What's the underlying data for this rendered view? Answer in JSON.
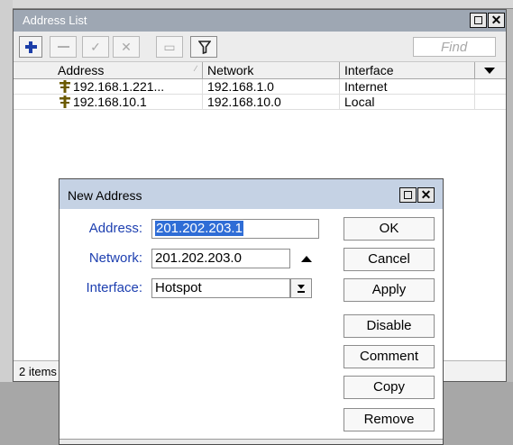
{
  "address_list": {
    "title": "Address List",
    "find_placeholder": "Find",
    "columns": {
      "address": "Address",
      "network": "Network",
      "interface": "Interface"
    },
    "rows": [
      {
        "address": "192.168.1.221...",
        "network": "192.168.1.0",
        "interface": "Internet"
      },
      {
        "address": "192.168.10.1",
        "network": "192.168.10.0",
        "interface": "Local"
      }
    ],
    "status": "2 items"
  },
  "new_address": {
    "title": "New Address",
    "fields": {
      "address_label": "Address:",
      "address_value": "201.202.203.1",
      "network_label": "Network:",
      "network_value": "201.202.203.0",
      "interface_label": "Interface:",
      "interface_value": "Hotspot"
    },
    "buttons": {
      "ok": "OK",
      "cancel": "Cancel",
      "apply": "Apply",
      "disable": "Disable",
      "comment": "Comment",
      "copy": "Copy",
      "remove": "Remove"
    }
  },
  "colors": {
    "list_title_bar": "#9ea7b3",
    "dialog_title_bar": "#c5d2e4",
    "field_label": "#1d3fb0",
    "selection": "#2f6dd6",
    "add_icon": "#1c3ea8",
    "address_icon": "#6b5a00"
  }
}
